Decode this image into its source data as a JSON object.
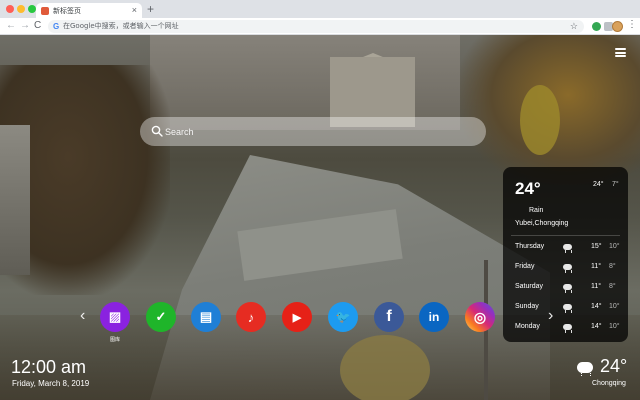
{
  "browser": {
    "tab_title": "新标签页",
    "tab_close": "×",
    "new_tab": "+",
    "back": "←",
    "forward": "→",
    "reload": "C",
    "omnibox_g": "G",
    "omnibox_placeholder": "在Google中搜索，或者输入一个网址",
    "star": "☆",
    "menu": "⋮"
  },
  "search": {
    "placeholder": "Search"
  },
  "weather_card": {
    "temp": "24°",
    "high": "24°",
    "low": "7°",
    "condition": "Rain",
    "location": "Yubei,Chongqing",
    "forecast": [
      {
        "day": "Thursday",
        "icon": "rain-cloud-icon",
        "high": "15°",
        "low": "10°"
      },
      {
        "day": "Friday",
        "icon": "rain-cloud-icon",
        "high": "11°",
        "low": "8°"
      },
      {
        "day": "Saturday",
        "icon": "rain-cloud-icon",
        "high": "11°",
        "low": "8°"
      },
      {
        "day": "Sunday",
        "icon": "rain-cloud-icon",
        "high": "14°",
        "low": "10°"
      },
      {
        "day": "Monday",
        "icon": "rain-cloud-icon",
        "high": "14°",
        "low": "10°"
      }
    ]
  },
  "dock": {
    "arrow_left": "‹",
    "arrow_right": "›",
    "apps": [
      {
        "name": "gallery",
        "color": "#8a22e0",
        "glyph": "▨",
        "label": "图库"
      },
      {
        "name": "tasks",
        "color": "#1fb52a",
        "glyph": "✓",
        "label": ""
      },
      {
        "name": "news",
        "color": "#1f7fd6",
        "glyph": "▤",
        "label": ""
      },
      {
        "name": "music",
        "color": "#e62c22",
        "glyph": "♪",
        "label": ""
      },
      {
        "name": "youtube",
        "color": "#e62117",
        "glyph": "▶",
        "label": ""
      },
      {
        "name": "twitter",
        "color": "#1d9bf0",
        "glyph": "🐦",
        "label": ""
      },
      {
        "name": "facebook",
        "color": "#3b5998",
        "glyph": "f",
        "label": ""
      },
      {
        "name": "linkedin",
        "color": "#0a66c2",
        "glyph": "in",
        "label": ""
      },
      {
        "name": "instagram",
        "color": "#d62976",
        "glyph": "◎",
        "label": ""
      }
    ]
  },
  "clock": {
    "time": "12:00 am",
    "date": "Friday, March 8, 2019"
  },
  "bottom_weather": {
    "temp": "24°",
    "city": "Chongqing"
  }
}
